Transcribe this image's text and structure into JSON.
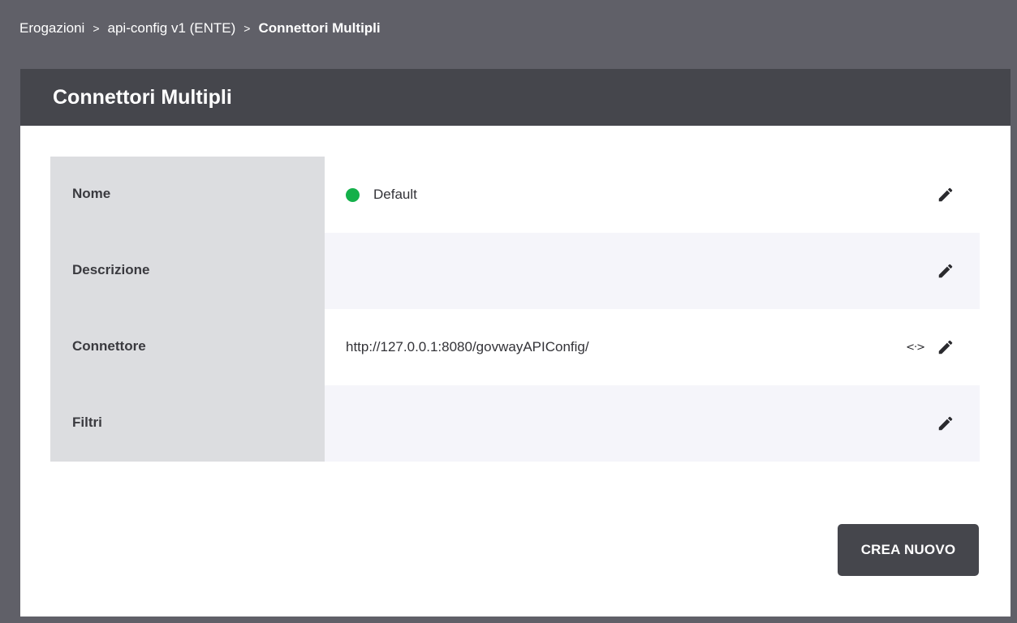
{
  "breadcrumb": {
    "items": [
      "Erogazioni",
      "api-config v1 (ENTE)"
    ],
    "separator": ">",
    "current": "Connettori Multipli"
  },
  "page": {
    "title": "Connettori Multipli"
  },
  "details": [
    {
      "label": "Nome",
      "value": "Default",
      "status": "active",
      "status_color": "#14b04a"
    },
    {
      "label": "Descrizione",
      "value": ""
    },
    {
      "label": "Connettore",
      "value": "http://127.0.0.1:8080/govwayAPIConfig/",
      "extra_icon": "<·>"
    },
    {
      "label": "Filtri",
      "value": ""
    }
  ],
  "icons": {
    "edit": "pencil-icon",
    "code": "code-brackets-icon"
  },
  "actions": {
    "create_label": "CREA NUOVO"
  },
  "colors": {
    "header": "#45464c",
    "background": "#606068",
    "label_column": "#dcdde0",
    "alt_row": "#f5f5fa"
  }
}
